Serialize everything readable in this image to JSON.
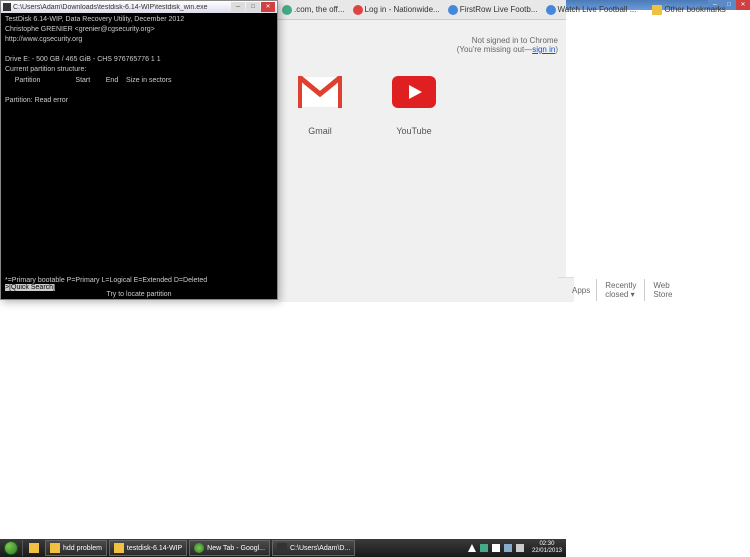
{
  "terminal": {
    "title": "C:\\Users\\Adam\\Downloads\\testdisk-6.14-WIP\\testdisk_win.exe",
    "lines": [
      "TestDisk 6.14-WIP, Data Recovery Utility, December 2012",
      "Christophe GRENIER <grenier@cgsecurity.org>",
      "http://www.cgsecurity.org",
      "",
      "Drive E: - 500 GB / 465 GiB - CHS 976765776 1 1",
      "Current partition structure:",
      "     Partition                  Start        End    Size in sectors",
      "",
      "Partition: Read error"
    ],
    "footer_legend": "*=Primary bootable  P=Primary  L=Logical  E=Extended  D=Deleted",
    "footer_highlight": ">[Quick Search]",
    "footer_hint": "Try to locate partition"
  },
  "chrome": {
    "bookmarks": [
      {
        "label": ".com, the off...",
        "icon": "green"
      },
      {
        "label": "Log in - Nationwide...",
        "icon": "red"
      },
      {
        "label": "FirstRow Live Footb...",
        "icon": "blue"
      },
      {
        "label": "Watch Live Football ...",
        "icon": "blue"
      }
    ],
    "other_bookmarks": "Other bookmarks",
    "signin_line1": "Not signed in to Chrome",
    "signin_line2_prefix": "(You're missing out—",
    "signin_link": "sign in",
    "signin_line2_suffix": ")",
    "apps": [
      {
        "name": "Gmail"
      },
      {
        "name": "YouTube"
      }
    ],
    "footer": {
      "apps": "Apps",
      "recently_closed": "Recently closed ▾",
      "web_store": "Web Store"
    }
  },
  "taskbar": {
    "items": [
      {
        "label": "hdd problem",
        "color": "#f0c040"
      },
      {
        "label": "testdisk-6.14-WIP",
        "color": "#f0c040"
      },
      {
        "label": "New Tab - Googl...",
        "color": "#4a8"
      },
      {
        "label": "C:\\Users\\Adam\\D...",
        "color": "#333"
      }
    ],
    "clock": {
      "time": "02:30",
      "date": "22/01/2013"
    }
  }
}
